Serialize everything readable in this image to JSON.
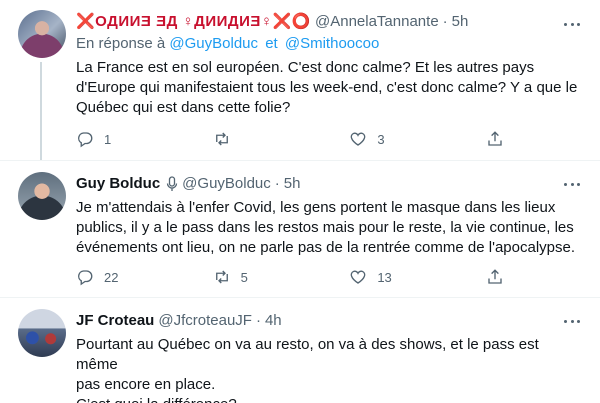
{
  "tweets": [
    {
      "name": "❌ОДИИƎ ƎД ♀ДИИДИƎ♀❌⭕",
      "handle": "@AnnelaTannante",
      "time": "5h",
      "reply_prefix": "En réponse à",
      "reply_users": [
        "@GuyBolduc",
        "et",
        "@Smithoocoo"
      ],
      "text_lines": [
        "La France est en sol européen. C'est donc calme? Et les autres pays",
        "d'Europe qui manifestaient tous les week-end, c'est donc calme? Y a que le",
        "Québec qui est dans cette folie?"
      ],
      "replies": "1",
      "retweets": "",
      "likes": "3"
    },
    {
      "name": "Guy Bolduc",
      "handle": "@GuyBolduc",
      "time": "5h",
      "text_lines": [
        "Je m'attendais à l'enfer Covid, les gens portent le masque dans les lieux",
        "publics, il y a le pass dans les restos mais pour le reste, la vie continue, les",
        "événements ont lieu, on ne parle pas de la rentrée comme de l'apocalypse."
      ],
      "replies": "22",
      "retweets": "5",
      "likes": "13"
    },
    {
      "name": "JF Croteau",
      "handle": "@JfcroteauJF",
      "time": "4h",
      "text_lines": [
        "Pourtant au Québec on va au resto, on va à des shows, et le pass est même",
        "pas encore en place.",
        "C’est quoi la différence?"
      ]
    }
  ],
  "colors": {
    "accent": "#1d9bf0",
    "muted": "#536471",
    "text": "#0f1419",
    "name_red": "#c8102e"
  },
  "icons": [
    "reply-icon",
    "retweet-icon",
    "like-icon",
    "share-icon",
    "more-icon",
    "microphone-icon"
  ]
}
